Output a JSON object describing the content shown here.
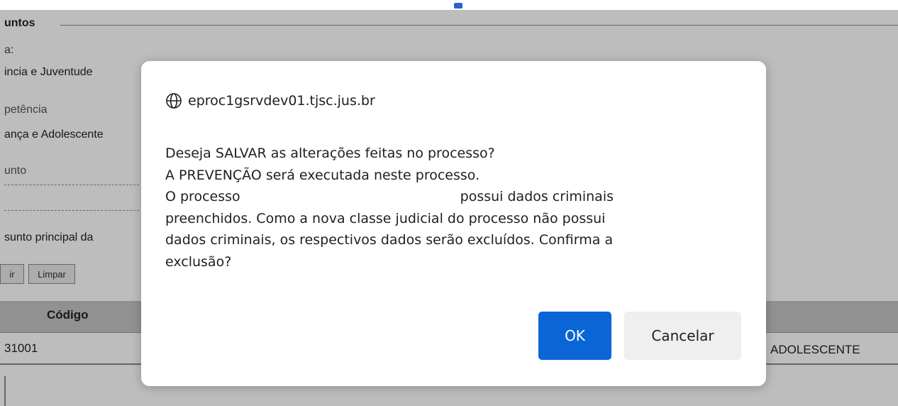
{
  "background": {
    "legend": "untos",
    "field1_label": "a:",
    "field1_value": "incia e Juventude",
    "field2_label": "petência",
    "field2_value": "ança e Adolescente",
    "field3_label": "unto",
    "field4_label": "sunto principal da",
    "btn_incluir": "ir",
    "btn_limpar": "Limpar",
    "table_header_codigo": "Código",
    "row_code": "31001",
    "row_desc": "ADOLESCENTE"
  },
  "dialog": {
    "origin": "eproc1gsrvdev01.tjsc.jus.br",
    "message_line1": "Deseja SALVAR as alterações feitas no processo?",
    "message_line2": "A PREVENÇÃO será executada neste processo.",
    "message_line3a": "O processo",
    "message_line3b": "possui dados criminais",
    "message_line4": "preenchidos. Como a nova classe judicial do processo não possui",
    "message_line5": "dados criminais, os respectivos dados serão excluídos. Confirma a",
    "message_line6": "exclusão?",
    "ok_label": "OK",
    "cancel_label": "Cancelar"
  },
  "colors": {
    "ok_button": "#0a66d6",
    "cancel_button": "#efefef",
    "overlay": "rgba(0,0,0,0.26)"
  },
  "icons": {
    "origin_icon": "globe-icon"
  }
}
